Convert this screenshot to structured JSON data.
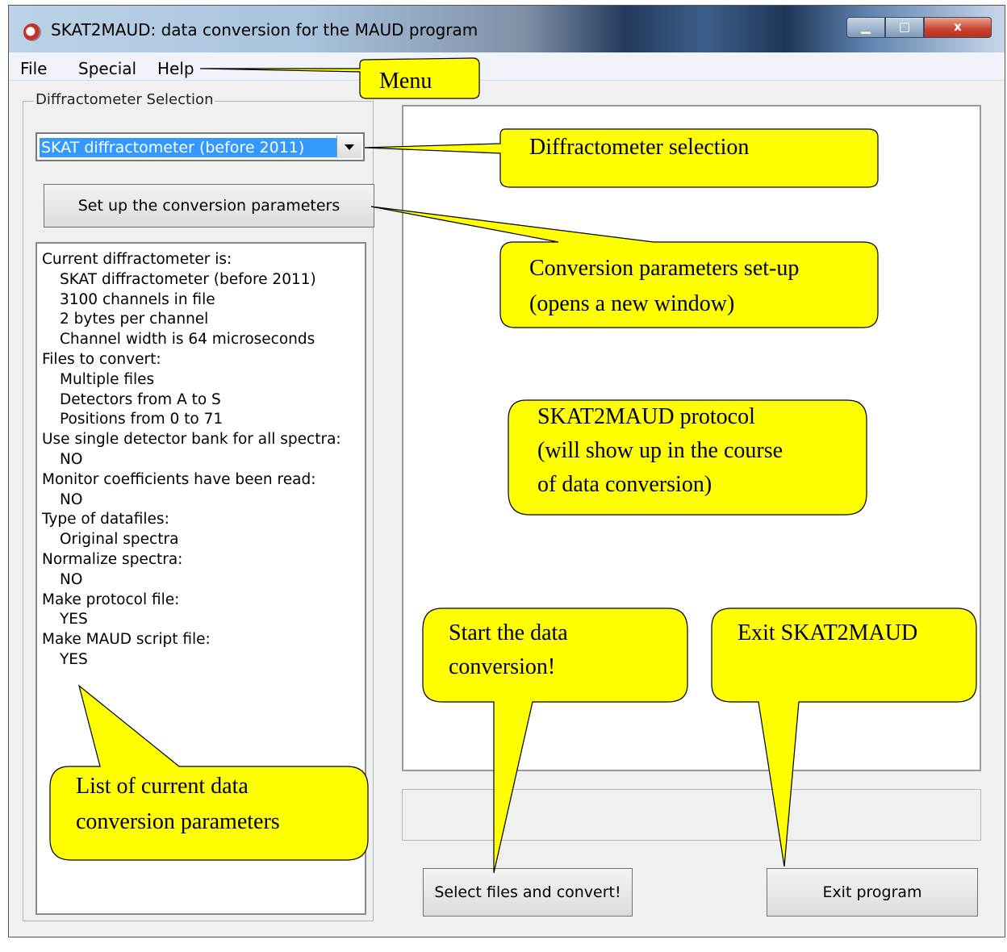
{
  "window": {
    "title": "SKAT2MAUD: data conversion for the MAUD program",
    "controls": {
      "minimize": "▁",
      "maximize": "□",
      "close": "x"
    }
  },
  "menu": {
    "items": [
      "File",
      "Special",
      "Help"
    ]
  },
  "diffractometer_group": {
    "legend": "Diffractometer Selection",
    "selected": "SKAT diffractometer (before 2011)"
  },
  "buttons": {
    "setup": "Set up the conversion parameters",
    "convert": "Select files and convert!",
    "exit": "Exit program"
  },
  "parameters": [
    "Current diffractometer is:",
    "SKAT diffractometer (before 2011)",
    "3100 channels in file",
    "2 bytes per channel",
    "Channel width is 64 microseconds",
    "Files to convert:",
    "Multiple files",
    "Detectors from A to S",
    "Positions from 0 to 71",
    "Use single detector bank for all spectra:",
    "NO",
    "Monitor coefficients have been read:",
    "NO",
    "Type of datafiles:",
    "Original spectra",
    "Normalize spectra:",
    "NO",
    "Make protocol file:",
    "YES",
    "Make MAUD script file:",
    "YES"
  ],
  "callouts": {
    "menu": "Menu",
    "diffractometer": "Diffractometer selection",
    "setup_line1": "Conversion parameters set-up",
    "setup_line2": "(opens a new window)",
    "protocol_line1": "SKAT2MAUD protocol",
    "protocol_line2": "(will show up in the course",
    "protocol_line3": "of data conversion)",
    "start_line1": "Start the data",
    "start_line2": "conversion!",
    "exit": "Exit SKAT2MAUD",
    "list_line1": "List of current data",
    "list_line2": "conversion parameters"
  },
  "colors": {
    "callout_fill": "#ffff00",
    "selection": "#3399ff"
  }
}
